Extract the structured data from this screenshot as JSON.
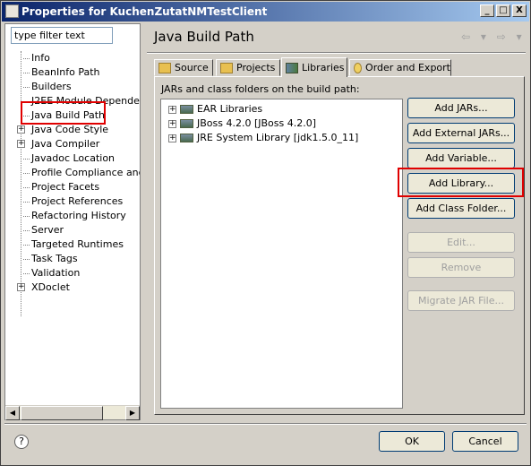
{
  "window": {
    "title": "Properties for KuchenZutatNMTestClient",
    "min": "_",
    "max": "□",
    "close": "X"
  },
  "filter": {
    "placeholder": "type filter text"
  },
  "tree": [
    {
      "label": "Info",
      "expandable": false
    },
    {
      "label": "BeanInfo Path",
      "expandable": false
    },
    {
      "label": "Builders",
      "expandable": false
    },
    {
      "label": "J2EE Module Dependenci",
      "expandable": false
    },
    {
      "label": "Java Build Path",
      "expandable": false
    },
    {
      "label": "Java Code Style",
      "expandable": true
    },
    {
      "label": "Java Compiler",
      "expandable": true
    },
    {
      "label": "Javadoc Location",
      "expandable": false
    },
    {
      "label": "Profile Compliance and Va",
      "expandable": false
    },
    {
      "label": "Project Facets",
      "expandable": false
    },
    {
      "label": "Project References",
      "expandable": false
    },
    {
      "label": "Refactoring History",
      "expandable": false
    },
    {
      "label": "Server",
      "expandable": false
    },
    {
      "label": "Targeted Runtimes",
      "expandable": false
    },
    {
      "label": "Task Tags",
      "expandable": false
    },
    {
      "label": "Validation",
      "expandable": false
    },
    {
      "label": "XDoclet",
      "expandable": true
    }
  ],
  "page": {
    "title": "Java Build Path",
    "back": "⇦ ▾",
    "forward": "⇨ ▾"
  },
  "tabs": [
    {
      "label": "Source"
    },
    {
      "label": "Projects"
    },
    {
      "label": "Libraries"
    },
    {
      "label": "Order and Export"
    }
  ],
  "libraries": {
    "caption": "JARs and class folders on the build path:",
    "items": [
      "EAR Libraries",
      "JBoss 4.2.0 [JBoss 4.2.0]",
      "JRE System Library [jdk1.5.0_11]"
    ]
  },
  "buttons": {
    "add_jars": "Add JARs...",
    "add_external_jars": "Add External JARs...",
    "add_variable": "Add Variable...",
    "add_library": "Add Library...",
    "add_class_folder": "Add Class Folder...",
    "edit": "Edit...",
    "remove": "Remove",
    "migrate": "Migrate JAR File...",
    "ok": "OK",
    "cancel": "Cancel"
  },
  "help": {
    "label": "?"
  },
  "colors": {
    "titlebar_start": "#0a246a",
    "highlight": "#e00000"
  }
}
